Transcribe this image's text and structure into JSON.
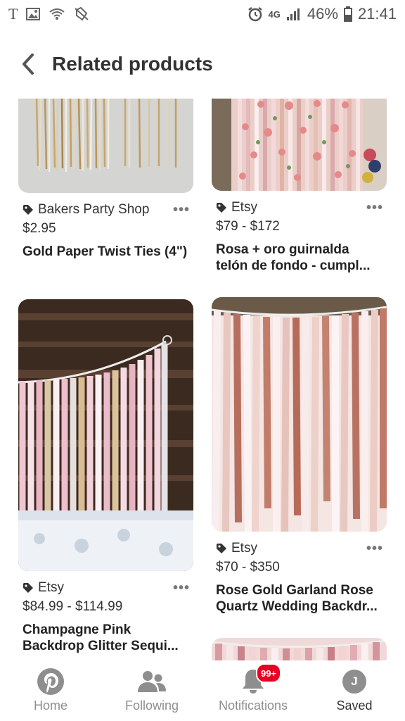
{
  "status_bar": {
    "battery_pct": "46%",
    "time": "21:41",
    "network": "4G"
  },
  "header": {
    "title": "Related products"
  },
  "cards": [
    {
      "source": "Bakers Party Shop",
      "price": "$2.95",
      "title": "Gold Paper Twist Ties (4\")"
    },
    {
      "source": "Etsy",
      "price": "$79 - $172",
      "title": "Rosa + oro guirnalda telón de fondo - cumpl..."
    },
    {
      "source": "Etsy",
      "price": "$84.99 - $114.99",
      "title": "Champagne Pink Backdrop Glitter Sequi..."
    },
    {
      "source": "Etsy",
      "price": "$70 - $350",
      "title": "Rose Gold Garland Rose Quartz Wedding Backdr..."
    }
  ],
  "more_label": "•••",
  "nav": {
    "home": "Home",
    "following": "Following",
    "notifications": "Notifications",
    "notifications_badge": "99+",
    "saved": "Saved",
    "avatar_initial": "J"
  },
  "colors": {
    "brand": "#e60023",
    "icon_gray": "#8e8e8e",
    "text": "#333333"
  }
}
